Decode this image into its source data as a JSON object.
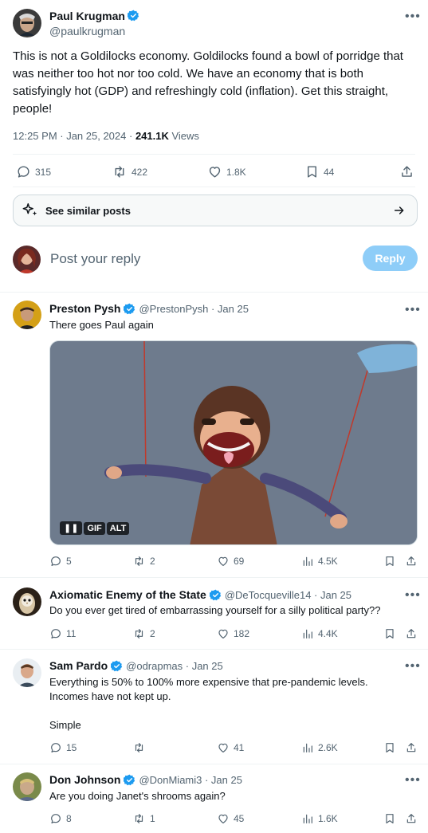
{
  "main_post": {
    "author": "Paul Krugman",
    "handle": "@paulkrugman",
    "text": "This is not a Goldilocks economy. Goldilocks found a bowl of porridge that was neither too hot nor too cold. We have an economy that is both satisfyingly hot (GDP) and refreshingly cold (inflation). Get this straight, people!",
    "time": "12:25 PM · Jan 25, 2024 · ",
    "views_count": "241.1K",
    "views_label": " Views",
    "replies": "315",
    "reposts": "422",
    "likes": "1.8K",
    "bookmarks": "44"
  },
  "similar": {
    "label": "See similar posts"
  },
  "composer": {
    "placeholder": "Post your reply",
    "button": "Reply"
  },
  "replies": [
    {
      "author": "Preston Pysh",
      "meta": "@PrestonPysh · Jan 25",
      "text": "There goes Paul again",
      "media_badges": {
        "gif": "GIF",
        "alt": "ALT"
      },
      "stats": {
        "replies": "5",
        "reposts": "2",
        "likes": "69",
        "views": "4.5K"
      }
    },
    {
      "author": "Axiomatic Enemy of the State",
      "meta": "@DeTocqueville14 · Jan 25",
      "text": "Do you ever get tired of embarrassing yourself for a silly political party??",
      "stats": {
        "replies": "11",
        "reposts": "2",
        "likes": "182",
        "views": "4.4K"
      }
    },
    {
      "author": "Sam Pardo",
      "meta": "@odrapmas · Jan 25",
      "text_line1": "Everything is 50% to 100% more expensive that pre-pandemic levels.",
      "text_line2": "Incomes have not kept up.",
      "text_line3": "Simple",
      "stats": {
        "replies": "15",
        "reposts": "",
        "likes": "41",
        "views": "2.6K"
      }
    },
    {
      "author": "Don Johnson",
      "meta": "@DonMiami3 · Jan 25",
      "text": "Are you doing Janet's shrooms again?",
      "stats": {
        "replies": "8",
        "reposts": "1",
        "likes": "45",
        "views": "1.6K"
      }
    }
  ],
  "colors": {
    "accent": "#1d9bf0",
    "reply_button": "#8ecdf8",
    "muted": "#536471",
    "divider": "#eff3f4"
  }
}
